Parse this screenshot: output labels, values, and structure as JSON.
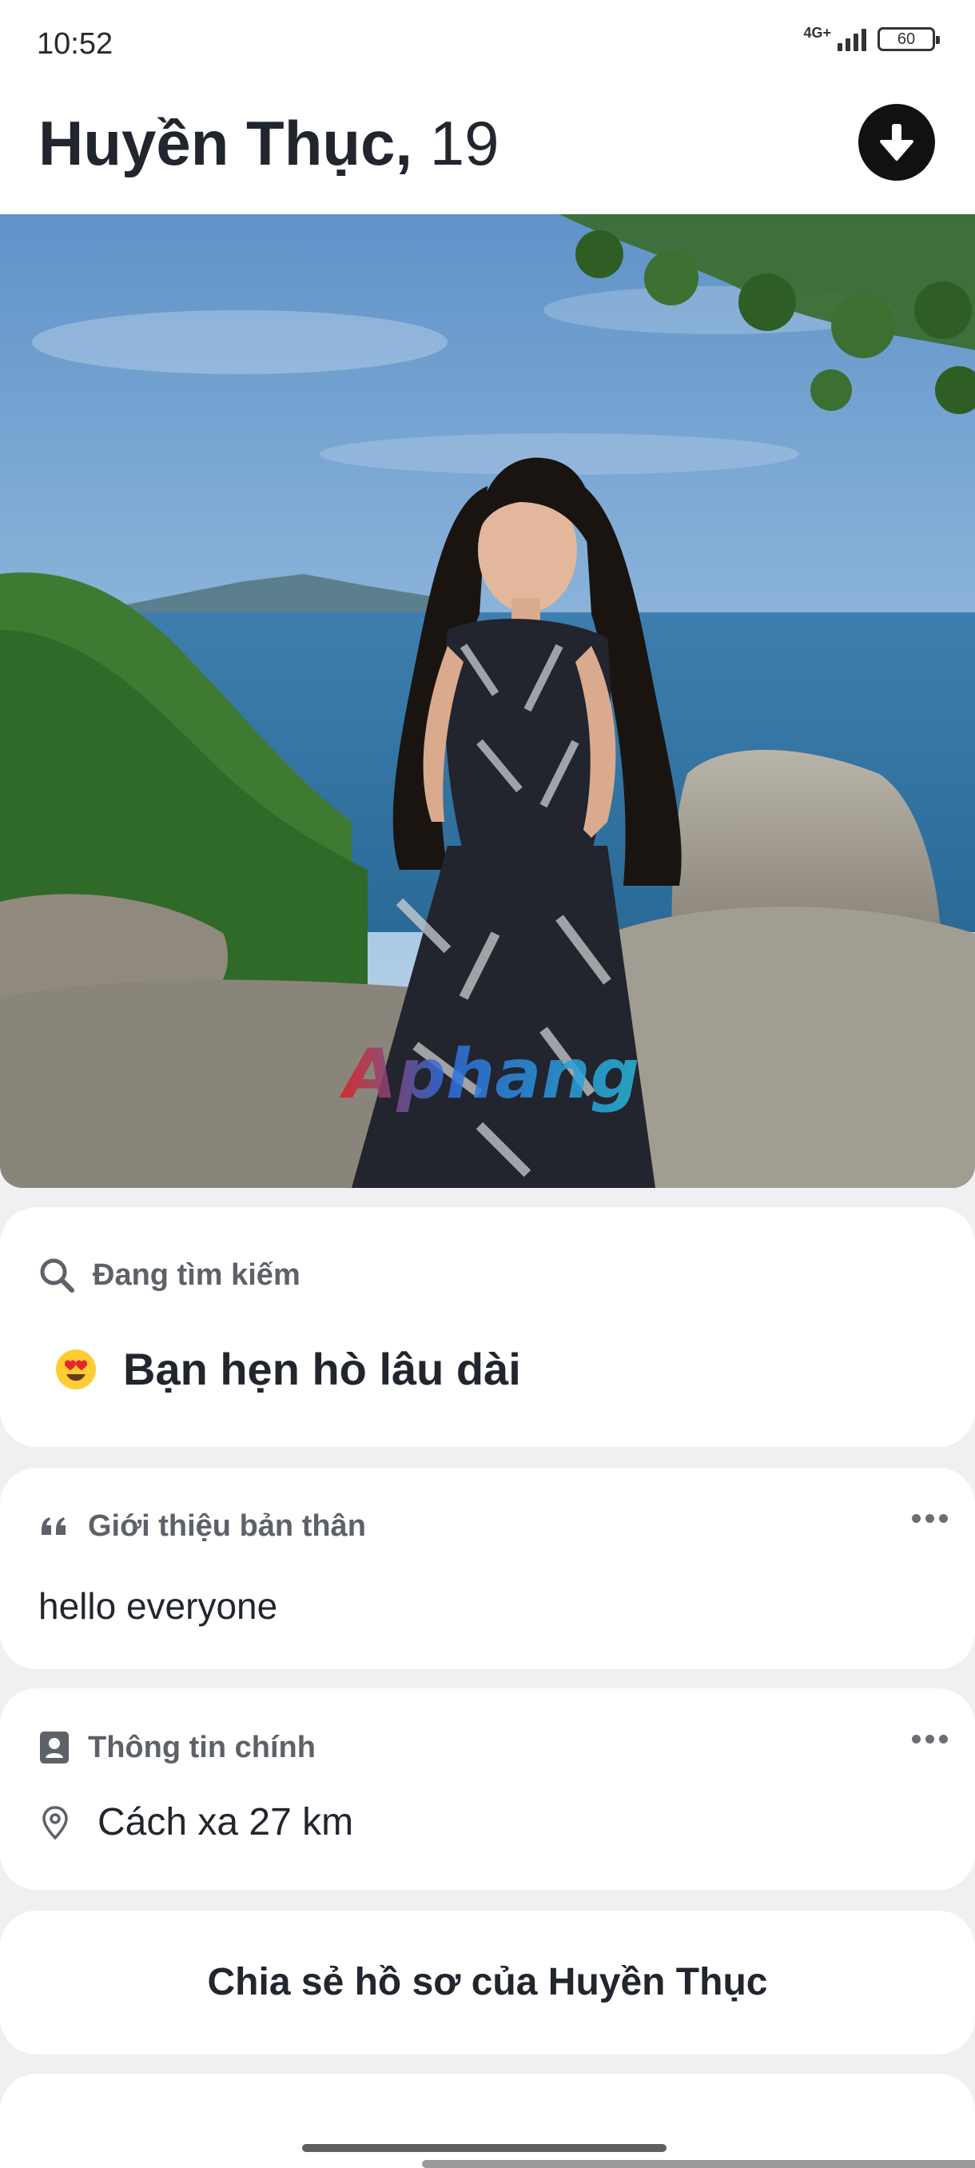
{
  "status_bar": {
    "time": "10:52",
    "network": "4G+",
    "battery": "60"
  },
  "profile": {
    "name": "Huyền Thục,",
    "age": "19"
  },
  "photo": {
    "watermark": "Aphang"
  },
  "looking_for": {
    "header": "Đang tìm kiếm",
    "emoji": "heart-eyes-emoji",
    "value": "Bạn hẹn hò lâu dài"
  },
  "bio": {
    "header": "Giới thiệu bản thân",
    "text": "hello everyone"
  },
  "basics": {
    "header": "Thông tin chính",
    "distance": "Cách xa 27 km"
  },
  "share": {
    "label": "Chia sẻ hồ sơ của Huyền Thục"
  },
  "colors": {
    "text_primary": "#21262e",
    "text_secondary": "#5d6168",
    "background": "#f0f0f3",
    "card": "#ffffff"
  }
}
